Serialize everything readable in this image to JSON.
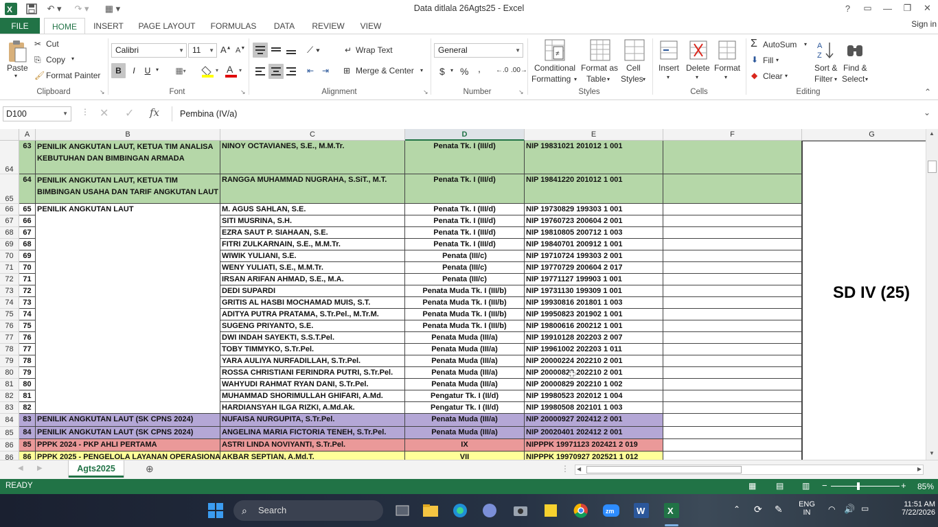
{
  "app": {
    "window_title": "Data ditlala 26Agts25 - Excel",
    "sign_in": "Sign in"
  },
  "ribbon_tabs": [
    "FILE",
    "HOME",
    "INSERT",
    "PAGE LAYOUT",
    "FORMULAS",
    "DATA",
    "REVIEW",
    "VIEW"
  ],
  "ribbon": {
    "clipboard": {
      "paste": "Paste",
      "cut": "Cut",
      "copy": "Copy",
      "format_painter": "Format Painter",
      "label": "Clipboard"
    },
    "font": {
      "name": "Calibri",
      "size": "11",
      "bold": "B",
      "italic": "I",
      "underline": "U",
      "label": "Font"
    },
    "alignment": {
      "wrap_text": "Wrap Text",
      "merge_center": "Merge & Center",
      "label": "Alignment"
    },
    "number": {
      "format": "General",
      "currency": "$",
      "percent": "%",
      "comma": ",",
      "label": "Number"
    },
    "styles": {
      "conditional": [
        "Conditional",
        "Formatting"
      ],
      "format_table": [
        "Format as",
        "Table"
      ],
      "cell_styles": [
        "Cell",
        "Styles"
      ],
      "label": "Styles"
    },
    "cells": {
      "insert": "Insert",
      "delete": "Delete",
      "format": "Format",
      "label": "Cells"
    },
    "editing": {
      "autosum": "AutoSum",
      "fill": "Fill",
      "clear": "Clear",
      "sort_filter": [
        "Sort &",
        "Filter"
      ],
      "find_select": [
        "Find &",
        "Select"
      ],
      "label": "Editing"
    }
  },
  "formula_bar": {
    "name_box": "D100",
    "formula": "Pembina (IV/a)",
    "fx": "fx"
  },
  "columns": [
    "A",
    "B",
    "C",
    "D",
    "E",
    "F",
    "G"
  ],
  "rows": [
    {
      "row": "64",
      "a": "63",
      "b": "PENILIK ANGKUTAN LAUT, KETUA TIM ANALISA KEBUTUHAN DAN  BIMBINGAN ARMADA",
      "c": "NINOY OCTAVIANES, S.E., M.M.Tr.",
      "d": "Penata Tk. I (III/d)",
      "e": "NIP 19831021 201012 1 001",
      "fill": "green"
    },
    {
      "row": "65",
      "a": "64",
      "b": "PENILIK ANGKUTAN LAUT, KETUA TIM BIMBINGAN USAHA DAN TARIF ANGKUTAN LAUT",
      "c": "RANGGA MUHAMMAD NUGRAHA, S.SiT., M.T.",
      "d": "Penata Tk. I (III/d)",
      "e": "NIP 19841220 201012 1 001",
      "fill": "green"
    },
    {
      "row": "66",
      "a": "65",
      "b": "PENILIK ANGKUTAN LAUT",
      "c": "M. AGUS SAHLAN, S.E.",
      "d": "Penata Tk. I (III/d)",
      "e": "NIP 19730829 199303 1 001",
      "fill": ""
    },
    {
      "row": "67",
      "a": "66",
      "b": "",
      "c": "SITI MUSRINA, S.H.",
      "d": "Penata Tk. I (III/d)",
      "e": "NIP 19760723 200604 2 001",
      "fill": ""
    },
    {
      "row": "68",
      "a": "67",
      "b": "",
      "c": "EZRA SAUT P. SIAHAAN, S.E.",
      "d": "Penata Tk. I (III/d)",
      "e": "NIP 19810805 200712 1 003",
      "fill": ""
    },
    {
      "row": "69",
      "a": "68",
      "b": "",
      "c": "FITRI ZULKARNAIN, S.E., M.M.Tr.",
      "d": "Penata Tk. I (III/d)",
      "e": "NIP 19840701 200912 1 001",
      "fill": ""
    },
    {
      "row": "70",
      "a": "69",
      "b": "",
      "c": "WIWIK YULIANI, S.E.",
      "d": "Penata (III/c)",
      "e": "NIP 19710724 199303 2 001",
      "fill": ""
    },
    {
      "row": "71",
      "a": "70",
      "b": "",
      "c": "WENY YULIATI, S.E., M.M.Tr.",
      "d": "Penata (III/c)",
      "e": "NIP 19770729 200604 2 017",
      "fill": ""
    },
    {
      "row": "72",
      "a": "71",
      "b": "",
      "c": "IRSAN ARIFAN AHMAD, S.E., M.A.",
      "d": "Penata (III/c)",
      "e": "NIP 19771127 199903 1 001",
      "fill": ""
    },
    {
      "row": "73",
      "a": "72",
      "b": "",
      "c": "DEDI SUPARDI",
      "d": "Penata Muda Tk. I (III/b)",
      "e": "NIP 19731130 199309 1 001",
      "fill": ""
    },
    {
      "row": "74",
      "a": "73",
      "b": "",
      "c": "GRITIS AL HASBI MOCHAMAD MUIS, S.T.",
      "d": "Penata Muda Tk. I (III/b)",
      "e": "NIP 19930816 201801 1 003",
      "fill": ""
    },
    {
      "row": "75",
      "a": "74",
      "b": "",
      "c": "ADITYA PUTRA PRATAMA, S.Tr.Pel., M.Tr.M.",
      "d": "Penata Muda Tk. I (III/b)",
      "e": "NIP 19950823 201902 1 001",
      "fill": ""
    },
    {
      "row": "76",
      "a": "75",
      "b": "",
      "c": "SUGENG PRIYANTO, S.E.",
      "d": "Penata Muda Tk. I (III/b)",
      "e": "NIP 19800616 200212 1 001",
      "fill": ""
    },
    {
      "row": "77",
      "a": "76",
      "b": "",
      "c": "DWI INDAH SAYEKTI, S.S.T.Pel.",
      "d": "Penata Muda (III/a)",
      "e": "NIP 19910128 202203 2 007",
      "fill": ""
    },
    {
      "row": "78",
      "a": "77",
      "b": "",
      "c": "TOBY TIMMYKO, S.Tr.Pel.",
      "d": "Penata Muda (III/a)",
      "e": "NIP 19961002 202203 1 011",
      "fill": ""
    },
    {
      "row": "79",
      "a": "78",
      "b": "",
      "c": "YARA AULIYA NURFADILLAH, S.Tr.Pel.",
      "d": "Penata Muda (III/a)",
      "e": "NIP 20000224 202210 2 001",
      "fill": ""
    },
    {
      "row": "80",
      "a": "79",
      "b": "",
      "c": "ROSSA CHRISTIANI FERINDRA PUTRI, S.Tr.Pel.",
      "d": "Penata Muda (III/a)",
      "e": "NIP 20000823 202210 2 001",
      "fill": ""
    },
    {
      "row": "81",
      "a": "80",
      "b": "",
      "c": "WAHYUDI RAHMAT RYAN DANI, S.Tr.Pel.",
      "d": "Penata Muda (III/a)",
      "e": "NIP 20000829 202210 1 002",
      "fill": ""
    },
    {
      "row": "82",
      "a": "81",
      "b": "",
      "c": "MUHAMMAD SHORIMULLAH GHIFARI, A.Md.",
      "d": "Pengatur Tk. I (II/d)",
      "e": "NIP 19980523 202012 1 004",
      "fill": ""
    },
    {
      "row": "83",
      "a": "82",
      "b": "",
      "c": "HARDIANSYAH ILGA RIZKI, A.Md.Ak.",
      "d": "Pengatur Tk. I (II/d)",
      "e": "NIP 19980508 202101 1 003",
      "fill": ""
    },
    {
      "row": "84",
      "a": "83",
      "b": "PENILIK ANGKUTAN LAUT (SK CPNS 2024)",
      "c": "NUFAISA NURGUPITA, S.Tr.Pel.",
      "d": "Penata Muda (III/a)",
      "e": "NIP 20000927 202412 2 001",
      "fill": "purple"
    },
    {
      "row": "85",
      "a": "84",
      "b": "PENILIK ANGKUTAN LAUT (SK CPNS 2024)",
      "c": "ANGELINA MARIA FICTORIA TENEH, S.Tr.Pel.",
      "d": "Penata Muda (III/a)",
      "e": "NIP 20020401 202412 2 001",
      "fill": "purple"
    },
    {
      "row": "86",
      "a": "85",
      "b": "PPPK 2024 - PKP AHLI PERTAMA",
      "c": "ASTRI LINDA NOVIYANTI, S.Tr.Pel.",
      "d": "IX",
      "e": "NIPPPK 19971123 202421 2 019",
      "fill": "pink"
    },
    {
      "row": "86",
      "a": "86",
      "b": "PPPK 2025 - PENGELOLA LAYANAN OPERASIONAL",
      "c": "AKBAR SEPTIAN, A.Md.T.",
      "d": "VII",
      "e": "NIPPPK 19970927 202521 1 012",
      "fill": "yellow"
    }
  ],
  "merged_g_text": "SD IV (25)",
  "sheet_tab": "Agts2025",
  "status": {
    "mode": "READY",
    "zoom": "85%"
  },
  "taskbar": {
    "search": "Search",
    "lang": "ENG",
    "lang_sub": "IN",
    "time": "11:51 AM",
    "date": "7/22/2026"
  }
}
